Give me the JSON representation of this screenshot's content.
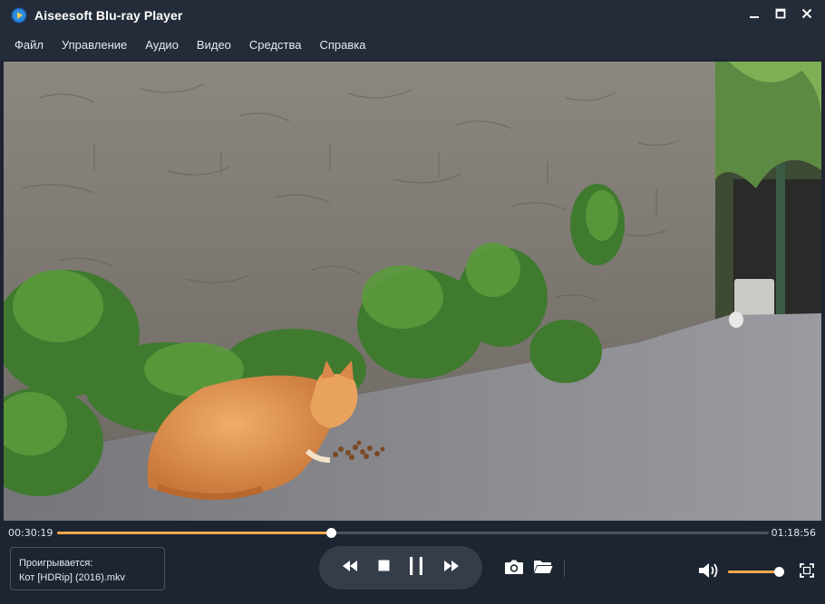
{
  "window": {
    "title": "Aiseesoft Blu-ray Player",
    "icon": "play-disc-icon",
    "controls": [
      "minimize-icon",
      "maximize-icon",
      "close-icon"
    ]
  },
  "menu": {
    "items": [
      {
        "label": "Файл"
      },
      {
        "label": "Управление"
      },
      {
        "label": "Аудио"
      },
      {
        "label": "Видео"
      },
      {
        "label": "Средства"
      },
      {
        "label": "Справка"
      }
    ]
  },
  "player": {
    "current_time": "00:30:19",
    "total_time": "01:18:56",
    "progress_fraction": 0.385,
    "now_playing_label": "Проигрывается:",
    "file_name": "Кот [HDRip] (2016).mkv",
    "volume_fraction": 0.93
  },
  "controls": {
    "transport": [
      "rewind-icon",
      "stop-icon",
      "pause-icon",
      "fast-forward-icon"
    ],
    "tools": [
      "camera-icon",
      "folder-icon"
    ],
    "right": [
      "volume-icon",
      "fullscreen-icon"
    ]
  },
  "colors": {
    "accent": "#f3a94a",
    "background": "#1e2532",
    "titlebar": "#252c39",
    "transport_bg": "#353d4b"
  }
}
